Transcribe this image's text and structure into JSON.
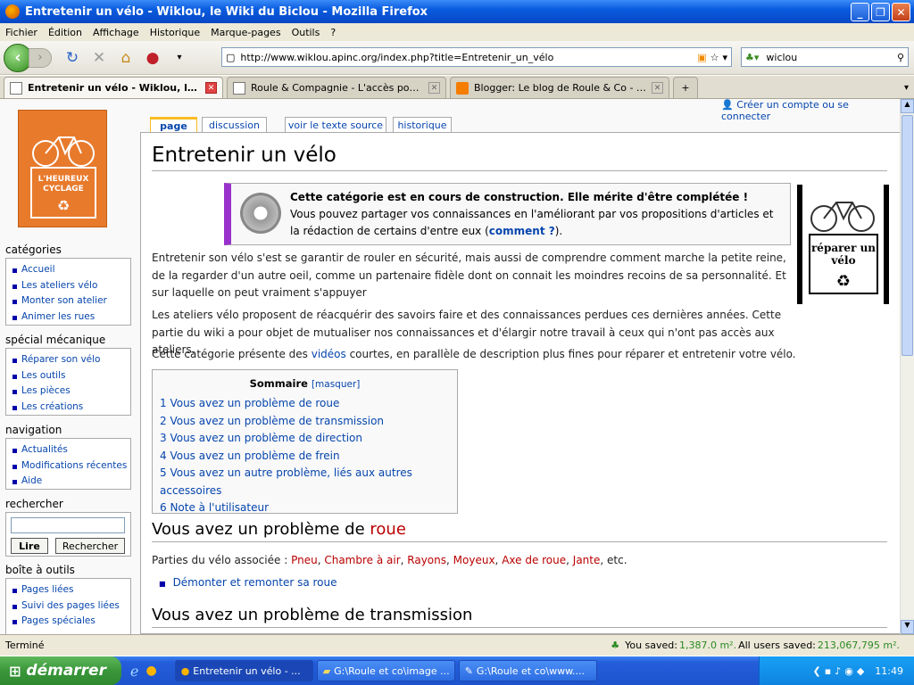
{
  "window": {
    "title": "Entretenir un vélo - Wiklou, le Wiki du Biclou - Mozilla Firefox"
  },
  "menu": [
    "Fichier",
    "Édition",
    "Affichage",
    "Historique",
    "Marque-pages",
    "Outils",
    "?"
  ],
  "navbar": {
    "url": "http://www.wiklou.apinc.org/index.php?title=Entretenir_un_vélo",
    "search_value": "wiclou"
  },
  "tabs": [
    {
      "label": "Entretenir un vélo - Wiklou, le Wi...",
      "active": true
    },
    {
      "label": "Roule & Compagnie - L'accès pour tous ...",
      "active": false
    },
    {
      "label": "Blogger: Le blog de Roule & Co - Modifi...",
      "active": false
    }
  ],
  "wiki": {
    "user_link": "Créer un compte ou se connecter",
    "logo_text": "L'HEUREUX CYCLAGE",
    "page_tabs": [
      "page",
      "discussion",
      "voir le texte source",
      "historique"
    ],
    "title": "Entretenir un vélo",
    "notice_bold": "Cette catégorie est en cours de construction. Elle mérite d'être complétée !",
    "notice_text": "Vous pouvez partager vos connaissances en l'améliorant par vos propositions d'articles et la rédaction de certains d'entre eux (",
    "notice_link": "comment ?",
    "notice_end": ").",
    "image_text": "réparer un vélo",
    "para1": "Entretenir son vélo s'est se garantir de rouler en sécurité, mais aussi de comprendre comment marche la petite reine, de la regarder d'un autre oeil, comme un partenaire fidèle dont on connait les moindres recoins de sa personnalité. Et sur laquelle on peut vraiment s'appuyer",
    "para2": "Les ateliers vélo proposent de réacquérir des savoirs faire et des connaissances perdues ces dernières années. Cette partie du wiki a pour objet de mutualiser nos connaissances et d'élargir notre travail à ceux qui n'ont pas accès aux ateliers.",
    "para3_a": "Cette catégorie présente des ",
    "para3_link": "vidéos",
    "para3_b": " courtes, en parallèle de description plus fines pour réparer et entretenir votre vélo.",
    "toc_title": "Sommaire",
    "toc_toggle": "[masquer]",
    "toc": [
      "1 Vous avez un problème de roue",
      "2 Vous avez un problème de transmission",
      "3 Vous avez un problème de direction",
      "4 Vous avez un problème de frein",
      "5 Vous avez un autre problème, liés aux autres accessoires",
      "6 Note à l'utilisateur"
    ],
    "h2_roue_a": "Vous avez un problème de ",
    "h2_roue_link": "roue",
    "parts_label": "Parties du vélo associée : ",
    "parts": [
      "Pneu",
      "Chambre à air",
      "Rayons",
      "Moyeux",
      "Axe de roue",
      "Jante"
    ],
    "parts_end": ", etc.",
    "bullet_link": "Démonter et remonter sa roue",
    "h2_transmission": "Vous avez un problème de transmission"
  },
  "sidebar": {
    "categories": {
      "title": "catégories",
      "items": [
        "Accueil",
        "Les ateliers vélo",
        "Monter son atelier",
        "Animer les rues"
      ]
    },
    "mecanique": {
      "title": "spécial mécanique",
      "items": [
        "Réparer son vélo",
        "Les outils",
        "Les pièces",
        "Les créations"
      ]
    },
    "navigation": {
      "title": "navigation",
      "items": [
        "Actualités",
        "Modifications récentes",
        "Aide"
      ]
    },
    "search": {
      "title": "rechercher",
      "btn_go": "Lire",
      "btn_search": "Rechercher"
    },
    "tools": {
      "title": "boîte à outils",
      "items": [
        "Pages liées",
        "Suivi des pages liées",
        "Pages spéciales"
      ]
    }
  },
  "status": {
    "left": "Terminé",
    "saved_label": "You saved: ",
    "saved_value": "1,387.0 m².",
    "all_label": " All users saved: ",
    "all_value": "213,067,795 m²."
  },
  "taskbar": {
    "start": "démarrer",
    "items": [
      "Entretenir un vélo - ...",
      "G:\\Roule et co\\image ...",
      "G:\\Roule et co\\www...."
    ],
    "clock": "11:49"
  }
}
